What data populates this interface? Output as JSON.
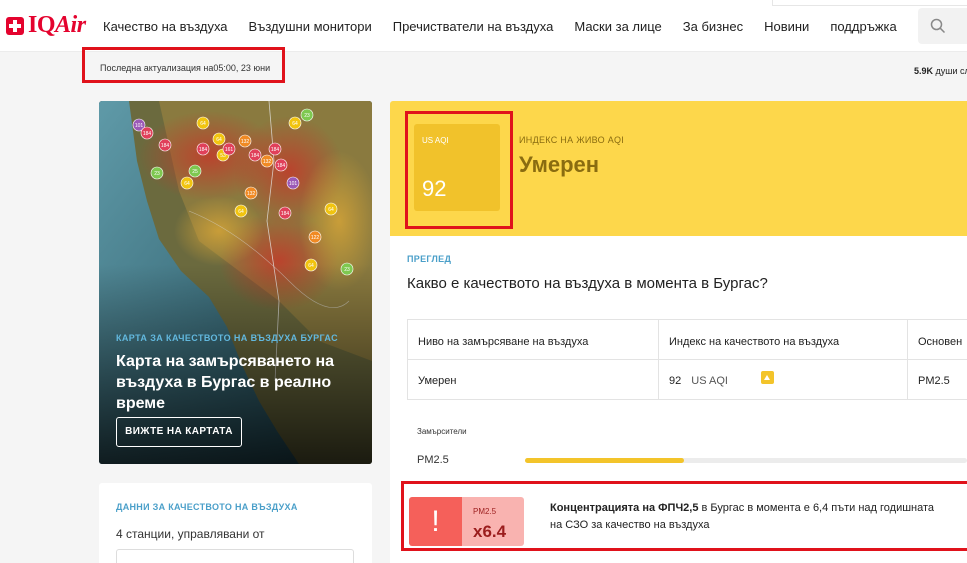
{
  "brand": {
    "logo_text_a": "IQ",
    "logo_text_b": "Air"
  },
  "nav": {
    "items": [
      "Качество на въздуха",
      "Въздушни монитори",
      "Пречистватели на въздуха",
      "Маски за лице",
      "За бизнес",
      "Новини",
      "поддръжка"
    ]
  },
  "header": {
    "last_update": "Последна актуализация на05:00, 23 юни",
    "followers_count": "5.9K",
    "followers_text": "души сл"
  },
  "map_card": {
    "label": "КАРТА ЗА КАЧЕСТВОТО НА ВЪЗДУХА БУРГАС",
    "title": "Карта на замърсяването на въздуха в Бургас в реално време",
    "button": "ВИЖТЕ НА КАРТАТА",
    "markers": [
      {
        "v": "101",
        "c": "#9b59b6"
      },
      {
        "v": "184",
        "c": "#e0405a"
      },
      {
        "v": "184",
        "c": "#e0405a"
      },
      {
        "v": "64",
        "c": "#f1c40f"
      },
      {
        "v": "23",
        "c": "#7ec850"
      },
      {
        "v": "64",
        "c": "#f1c40f"
      },
      {
        "v": "132",
        "c": "#f08a24"
      },
      {
        "v": "184",
        "c": "#e0405a"
      },
      {
        "v": "64",
        "c": "#f1c40f"
      },
      {
        "v": "53",
        "c": "#f1c40f"
      },
      {
        "v": "161",
        "c": "#e0405a"
      },
      {
        "v": "184",
        "c": "#e0405a"
      },
      {
        "v": "132",
        "c": "#f08a24"
      },
      {
        "v": "184",
        "c": "#e0405a"
      },
      {
        "v": "23",
        "c": "#7ec850"
      },
      {
        "v": "25",
        "c": "#7ec850"
      },
      {
        "v": "64",
        "c": "#f1c40f"
      },
      {
        "v": "132",
        "c": "#f08a24"
      },
      {
        "v": "184",
        "c": "#e0405a"
      },
      {
        "v": "101",
        "c": "#9b59b6"
      },
      {
        "v": "184",
        "c": "#e0405a"
      },
      {
        "v": "64",
        "c": "#f1c40f"
      },
      {
        "v": "122",
        "c": "#f08a24"
      },
      {
        "v": "64",
        "c": "#f1c40f"
      },
      {
        "v": "64",
        "c": "#f1c40f"
      },
      {
        "v": "23",
        "c": "#7ec850"
      }
    ]
  },
  "data_card": {
    "label": "ДАННИ ЗА КАЧЕСТВОТО НА ВЪЗДУХА",
    "text": "4 станции, управлявани от"
  },
  "aqi": {
    "unit": "US AQI",
    "value": "92",
    "live_label": "ИНДЕКС НА ЖИВО AQI",
    "status": "Умерен",
    "color": "#fdd74b"
  },
  "overview": {
    "label": "ПРЕГЛЕД",
    "question": "Какво е качеството на въздуха в момента в Бургас?",
    "table": {
      "headers": [
        "Ниво на замърсяване на въздуха",
        "Индекс на качеството на въздуха",
        "Основен"
      ],
      "row": {
        "level": "Умерен",
        "index_value": "92",
        "index_unit": "US AQI",
        "main": "PM2.5"
      }
    },
    "pollutants_label": "Замърсители",
    "pollutant": {
      "name": "PM2.5",
      "level": 0.36
    }
  },
  "alert": {
    "bang": "!",
    "unit": "PM2.5",
    "factor": "x6.4",
    "text_bold": "Концентрацията на ФПЧ2,5",
    "text_rest": " в Бургас в момента е 6,4 пъти над годишната",
    "text_line2": "на СЗО за качество на въздуха"
  }
}
